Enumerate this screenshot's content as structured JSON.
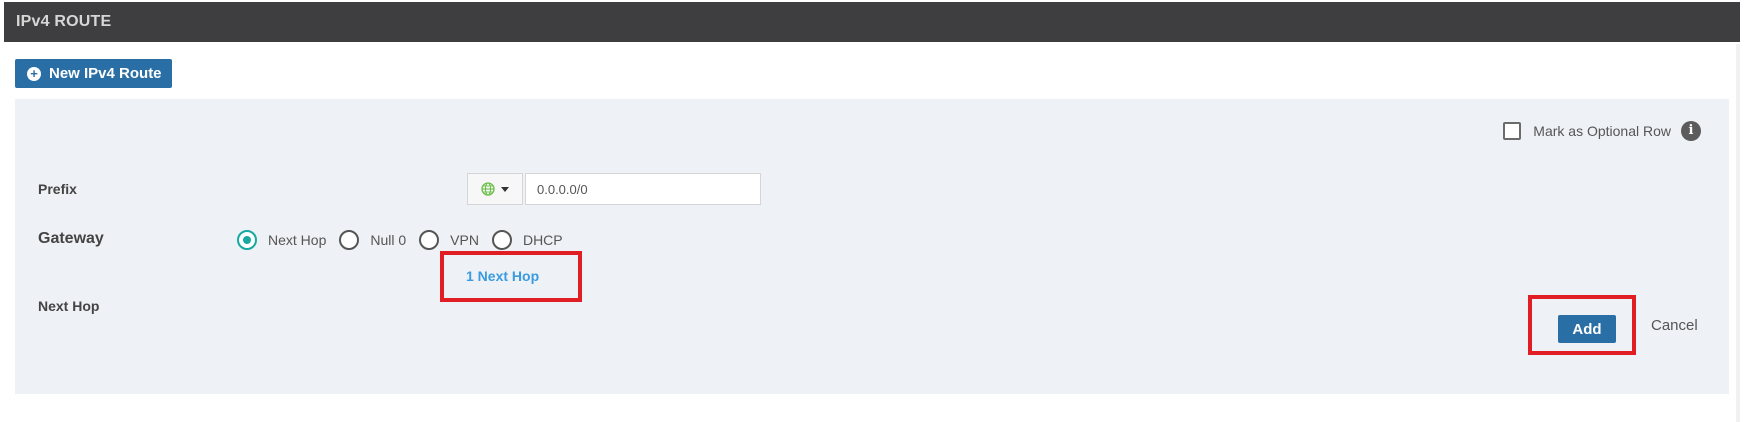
{
  "header": {
    "title": "IPv4 ROUTE"
  },
  "toolbar": {
    "new_route_label": "New IPv4 Route",
    "new_route_icon": "plus-circle-icon"
  },
  "form": {
    "optional_row_label": "Mark as Optional Row",
    "optional_row_checked": false,
    "info_icon": "info-icon",
    "prefix": {
      "label": "Prefix",
      "scope_icon": "globe-icon",
      "value": "0.0.0.0/0"
    },
    "gateway": {
      "label": "Gateway",
      "options": [
        {
          "label": "Next Hop",
          "checked": true
        },
        {
          "label": "Null 0",
          "checked": false
        },
        {
          "label": "VPN",
          "checked": false
        },
        {
          "label": "DHCP",
          "checked": false
        }
      ]
    },
    "next_hop": {
      "label": "Next Hop",
      "link_text": "1 Next Hop"
    },
    "actions": {
      "add_label": "Add",
      "cancel_label": "Cancel"
    }
  },
  "colors": {
    "header_bg": "#3e3e40",
    "primary_button": "#2a6ea6",
    "radio_checked": "#16a9a0",
    "link": "#3b9be0",
    "highlight": "#e01e24",
    "form_bg": "#eef1f5"
  }
}
